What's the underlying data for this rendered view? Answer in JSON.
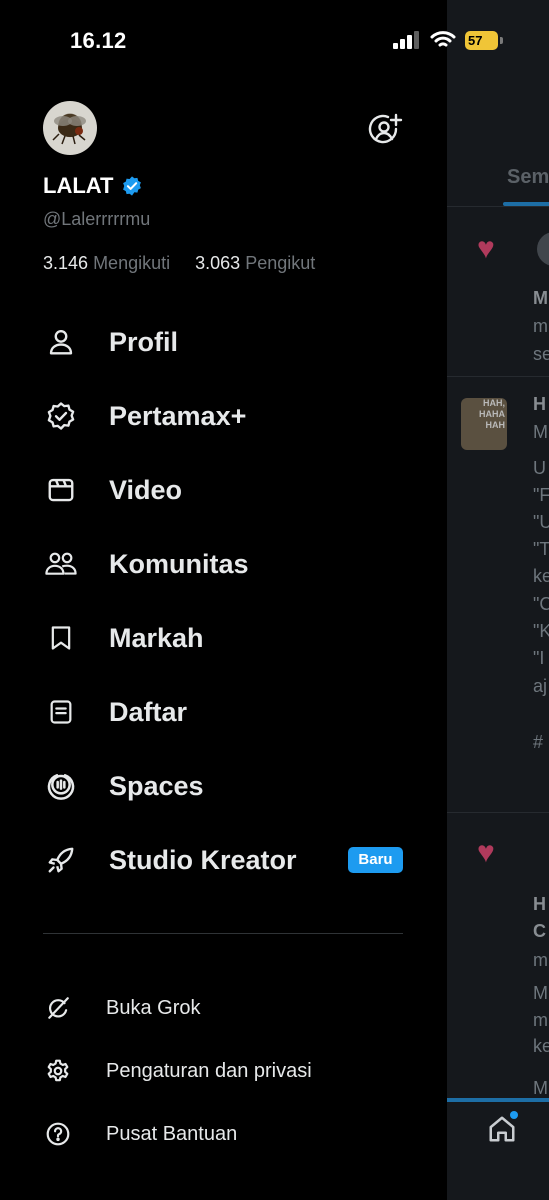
{
  "status_bar": {
    "time": "16.12",
    "battery": "57"
  },
  "profile": {
    "name": "LALAT",
    "handle": "@Lalerrrrrmu",
    "following_count": "3.146",
    "following_label": "Mengikuti",
    "followers_count": "3.063",
    "followers_label": "Pengikut"
  },
  "nav": [
    {
      "label": "Profil",
      "icon": "person-icon"
    },
    {
      "label": "Pertamax+",
      "icon": "verified-badge-icon"
    },
    {
      "label": "Video",
      "icon": "video-icon"
    },
    {
      "label": "Komunitas",
      "icon": "communities-icon"
    },
    {
      "label": "Markah",
      "icon": "bookmark-icon"
    },
    {
      "label": "Daftar",
      "icon": "list-icon"
    },
    {
      "label": "Spaces",
      "icon": "spaces-icon"
    },
    {
      "label": "Studio Kreator",
      "icon": "rocket-icon",
      "badge": "Baru"
    }
  ],
  "secondary": [
    {
      "label": "Buka Grok",
      "icon": "grok-icon"
    },
    {
      "label": "Pengaturan dan privasi",
      "icon": "gear-icon"
    },
    {
      "label": "Pusat Bantuan",
      "icon": "help-icon"
    }
  ],
  "background": {
    "tab_label": "Sem",
    "fragments": [
      "M",
      "m",
      "se",
      "H",
      "M",
      "U",
      "\"F",
      "\"U",
      "\"T",
      "ke",
      "\"C",
      "\"K",
      "\"I",
      "aj",
      "#",
      "H",
      "C",
      "m",
      "M",
      "m",
      "ke",
      "M"
    ],
    "face_text": "HAH, HAHA HAH"
  },
  "colors": {
    "accent": "#1d9bf0",
    "background": "#000000",
    "muted": "#71767b",
    "battery": "#f0c537"
  }
}
